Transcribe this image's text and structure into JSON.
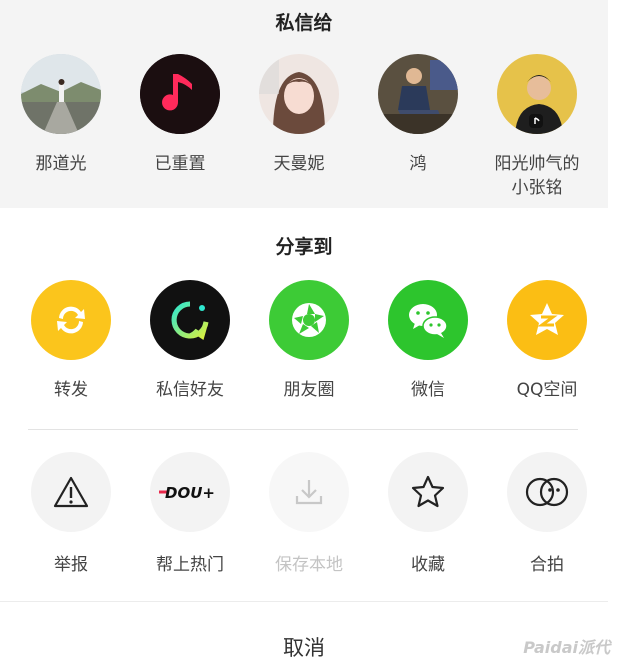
{
  "private_message": {
    "title": "私信给",
    "contacts": [
      {
        "name": "那道光"
      },
      {
        "name": "已重置"
      },
      {
        "name": "天曼妮"
      },
      {
        "name": "鸿"
      },
      {
        "name_line1": "阳光帅气的",
        "name_line2": "小张铭"
      }
    ]
  },
  "share": {
    "title": "分享到",
    "targets": [
      {
        "label": "转发",
        "icon": "repost-icon",
        "color": "#FBC51C"
      },
      {
        "label": "私信好友",
        "icon": "private-message-icon",
        "color": "#111111"
      },
      {
        "label": "朋友圈",
        "icon": "moments-icon",
        "color": "#3DCB36"
      },
      {
        "label": "微信",
        "icon": "wechat-icon",
        "color": "#2DC52D"
      },
      {
        "label": "QQ空间",
        "icon": "qzone-icon",
        "color": "#FBBE14"
      }
    ]
  },
  "actions": [
    {
      "label": "举报",
      "icon": "warning-icon"
    },
    {
      "label": "帮上热门",
      "icon": "dou-plus-icon",
      "badge": "DOU+"
    },
    {
      "label": "保存本地",
      "icon": "download-icon",
      "disabled": true
    },
    {
      "label": "收藏",
      "icon": "star-icon"
    },
    {
      "label": "合拍",
      "icon": "duet-icon"
    }
  ],
  "cancel_label": "取消",
  "watermark": "Paidai派代"
}
